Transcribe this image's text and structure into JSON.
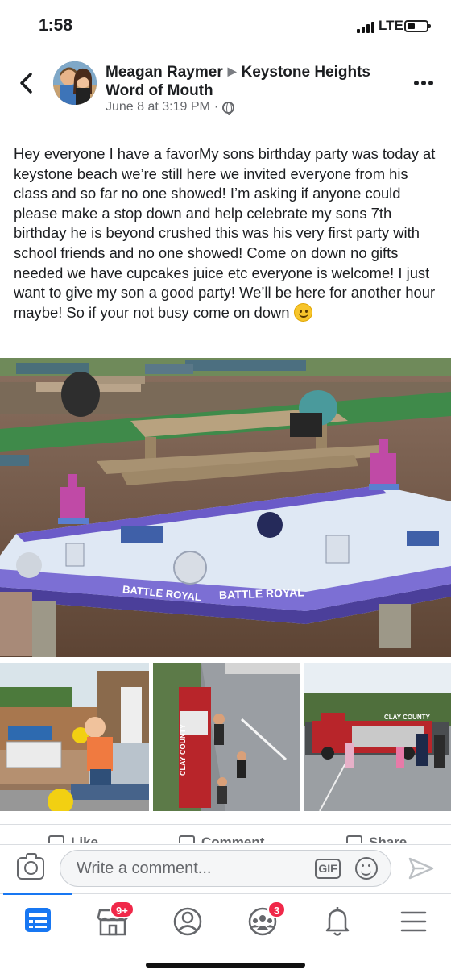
{
  "status_bar": {
    "time": "1:58",
    "network": "LTE"
  },
  "post": {
    "author": "Meagan Raymer",
    "group": "Keystone Heights Word of Mouth",
    "timestamp": "June 8 at 3:19 PM",
    "separator": "·",
    "body": "Hey everyone I have a favorMy sons birthday party was today at keystone beach we’re still here we invited everyone from his class and so far no one showed! I’m asking if anyone could please make a stop down and help celebrate my sons 7th birthday he is beyond crushed this was his very first party with school friends and no one showed! Come on down no gifts needed we have cupcakes juice etc everyone is welcome! I just want to give my son a good party! We’ll be here for another hour maybe! So if your not busy come on down",
    "tablecloth_text_1": "BATTLE ROYAL",
    "tablecloth_text_2": "BATTLE ROYAL",
    "truck_text": "CLAY COUNTY",
    "truck_text_2": "CLAY COUNTY"
  },
  "actions": {
    "like": "Like",
    "comment": "Comment",
    "share": "Share"
  },
  "comment_bar": {
    "placeholder": "Write a comment...",
    "gif_label": "GIF"
  },
  "nav": {
    "marketplace_badge": "9+",
    "groups_badge": "3"
  },
  "colors": {
    "brand": "#1877f2",
    "badge": "#f02849",
    "secondary_text": "#65676b"
  }
}
